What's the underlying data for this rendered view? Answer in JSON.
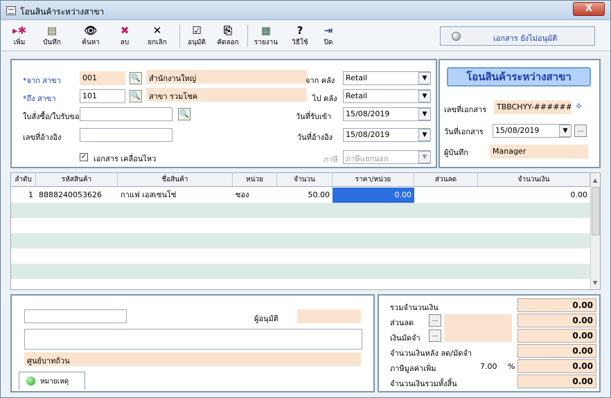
{
  "window": {
    "title": "โอนสินค้าระหว่างสาขา",
    "close": "X"
  },
  "toolbar": {
    "items": [
      {
        "label": "เพิ่ม",
        "icon": "add-icon",
        "glyph": "▸✱"
      },
      {
        "label": "บันทึก",
        "icon": "save-icon",
        "glyph": "▤"
      },
      {
        "label": "ค้นหา",
        "icon": "search-binoculars-icon",
        "glyph": "👁"
      },
      {
        "label": "ลบ",
        "icon": "delete-icon",
        "glyph": "✖"
      },
      {
        "label": "ยกเลิก",
        "icon": "cancel-icon",
        "glyph": "✕"
      },
      {
        "label": "อนุมัติ",
        "icon": "approve-icon",
        "glyph": "☑"
      },
      {
        "label": "คัดลอก",
        "icon": "copy-icon",
        "glyph": "⎘"
      },
      {
        "label": "รายงาน",
        "icon": "report-icon",
        "glyph": "▦"
      },
      {
        "label": "วิธีใช้",
        "icon": "help-icon",
        "glyph": "?"
      },
      {
        "label": "ปิด",
        "icon": "exit-icon",
        "glyph": "⇥"
      }
    ],
    "status": "เอกสาร ยังไม่อนุมัติ"
  },
  "header": {
    "from_branch_label": "*จาก สาขา",
    "from_branch_code": "001",
    "from_branch_name": "สำนักงานใหญ่",
    "to_branch_label": "*ถึง สาขา",
    "to_branch_code": "101",
    "to_branch_name": "สาขา รวมโชค",
    "po_label": "ใบสั่งซื้อ/ใบรับของ",
    "po_value": "",
    "ref_label": "เลขที่อ้างอิง",
    "ref_value": "",
    "from_wh_label": "จาก คลัง",
    "from_wh": "Retail",
    "to_wh_label": "ไป คลัง",
    "to_wh": "Retail",
    "receive_date_label": "วันที่รับเข้า",
    "receive_date": "15/08/2019",
    "ref_date_label": "วันที่อ้างอิง",
    "ref_date": "15/08/2019",
    "tax_label": "ภาษี",
    "tax_value": "ภาษีแยกนอก",
    "move_doc_label": "เอกสาร เคลื่อนไหว",
    "move_doc_checked": "✓"
  },
  "doc": {
    "title": "โอนสินค้าระหว่างสาขา",
    "doc_no_label": "เลขที่เอกสาร",
    "doc_no": "TBBCHYY-######",
    "doc_date_label": "วันที่เอกสาร",
    "doc_date": "15/08/2019",
    "recorder_label": "ผู้บันทึก",
    "recorder": "Manager"
  },
  "grid": {
    "columns": [
      "ลำดับ",
      "รหัสสินค้า",
      "ชื่อสินค้า",
      "หน่วย",
      "จำนวน",
      "ราคา/หน่วย",
      "ส่วนลด",
      "จำนวนเงิน"
    ],
    "rows": [
      {
        "seq": "1",
        "code": "8888240053626",
        "name": "กาแฟ เอสเซนโซ่",
        "unit": "ซอง",
        "qty": "50.00",
        "price": "0.00",
        "discount": "",
        "amount": "0.00"
      }
    ]
  },
  "footer": {
    "approver_label": "ผู้อนุมัติ",
    "approver": "",
    "amount_text": "ศูนย์บาทถ้วน",
    "note_tab": "หมายเหตุ"
  },
  "totals": {
    "sum_label": "รวมจำนวนเงิน",
    "sum": "0.00",
    "discount_label": "ส่วนลด",
    "discount": "0.00",
    "deposit_label": "เงินมัดจำ",
    "deposit": "0.00",
    "after_label": "จำนวนเงินหลัง ลด/มัดจำ",
    "after": "0.00",
    "vat_label": "ภาษีมูลค่าเพิ่ม",
    "vat_rate": "7.00",
    "vat_pct": "%",
    "vat": "0.00",
    "grand_label": "จำนวนเงินรวมทั้งสิ้น",
    "grand": "0.00"
  }
}
